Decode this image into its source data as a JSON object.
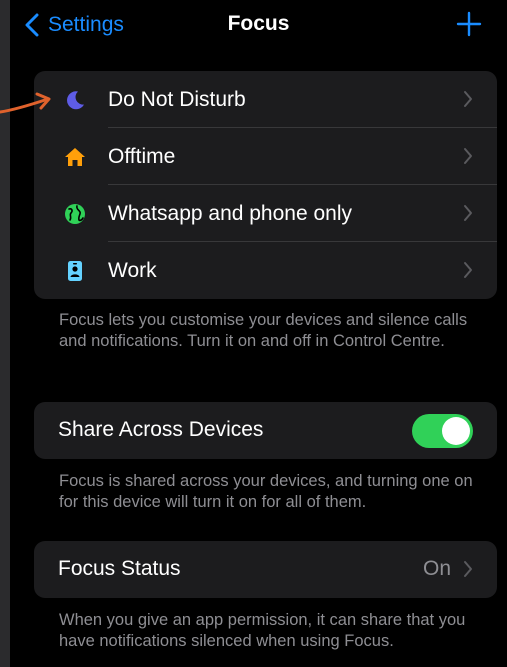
{
  "nav": {
    "back_label": "Settings",
    "title": "Focus"
  },
  "focus_modes": [
    {
      "label": "Do Not Disturb",
      "icon": "moon-icon",
      "color": "#5e5ce6"
    },
    {
      "label": "Offtime",
      "icon": "house-icon",
      "color": "#ff9f0a"
    },
    {
      "label": "Whatsapp and phone only",
      "icon": "globe-icon",
      "color": "#30d158"
    },
    {
      "label": "Work",
      "icon": "id-badge-icon",
      "color": "#64d2ff"
    }
  ],
  "focus_footer": "Focus lets you customise your devices and silence calls and notifications. Turn it on and off in Control Centre.",
  "share": {
    "label": "Share Across Devices",
    "enabled": true,
    "footer": "Focus is shared across your devices, and turning one on for this device will turn it on for all of them."
  },
  "status": {
    "label": "Focus Status",
    "value": "On",
    "footer": "When you give an app permission, it can share that you have notifications silenced when using Focus."
  },
  "colors": {
    "accent": "#1a8cff",
    "toggle_on": "#30d158",
    "annotation_arrow": "#e0622c"
  }
}
